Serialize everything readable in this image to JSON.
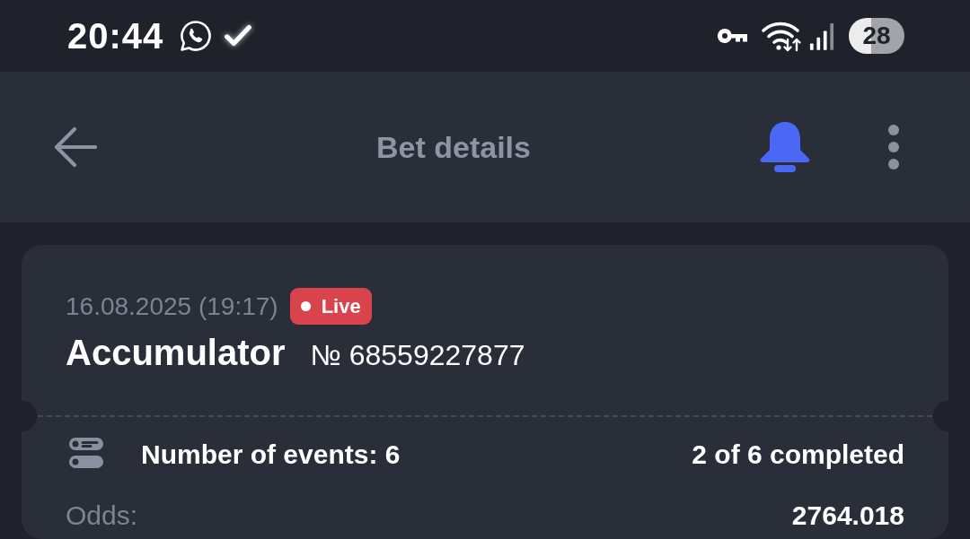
{
  "status_bar": {
    "time": "20:44",
    "battery": "28"
  },
  "header": {
    "title": "Bet details"
  },
  "bet": {
    "date": "16.08.2025 (19:17)",
    "badge": "Live",
    "type": "Accumulator",
    "number": "№ 68559227877",
    "events_label": "Number of events: 6",
    "events_summary": "2 of 6 completed",
    "rows": [
      {
        "label": "Odds:",
        "value": "2764.018"
      }
    ]
  }
}
